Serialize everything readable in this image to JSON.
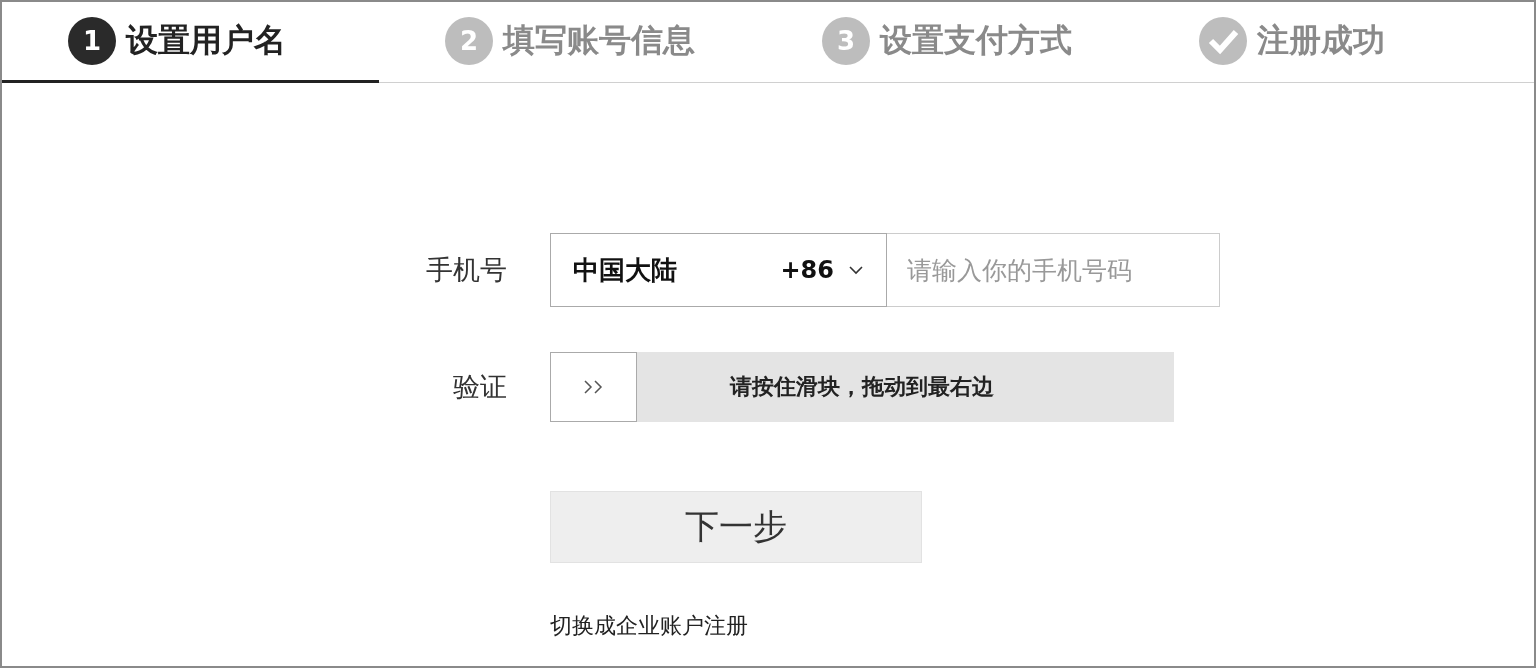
{
  "steps": [
    {
      "kind": "number",
      "number": "1",
      "label": "设置用户名",
      "selected": true
    },
    {
      "kind": "number",
      "number": "2",
      "label": "填写账号信息",
      "selected": false
    },
    {
      "kind": "number",
      "number": "3",
      "label": "设置支付方式",
      "selected": false
    },
    {
      "kind": "check",
      "label": "注册成功",
      "selected": false
    }
  ],
  "phone": {
    "label": "手机号",
    "region": "中国大陆",
    "code": "+86",
    "placeholder": "请输入你的手机号码"
  },
  "verify": {
    "label": "验证",
    "hint": "请按住滑块，拖动到最右边",
    "level": 0
  },
  "next_button": "下一步",
  "switch_link": "切换成企业账户注册"
}
